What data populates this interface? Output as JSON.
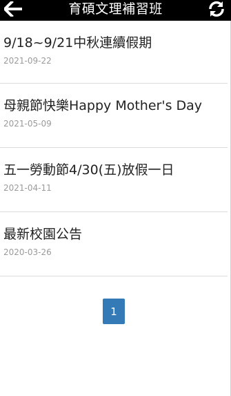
{
  "header": {
    "title": "育碩文理補習班",
    "back_icon": "arrow-left-icon",
    "refresh_icon": "refresh-icon"
  },
  "news": [
    {
      "title": "9/18~9/21中秋連續假期",
      "date": "2021-09-22"
    },
    {
      "title": "母親節快樂Happy Mother's Day",
      "date": "2021-05-09"
    },
    {
      "title": "五一勞動節4/30(五)放假一日",
      "date": "2021-04-11"
    },
    {
      "title": "最新校園公告",
      "date": "2020-03-26"
    }
  ],
  "pagination": {
    "current_page": "1"
  },
  "colors": {
    "header_bg": "#000000",
    "page_button_bg": "#337ab7"
  }
}
